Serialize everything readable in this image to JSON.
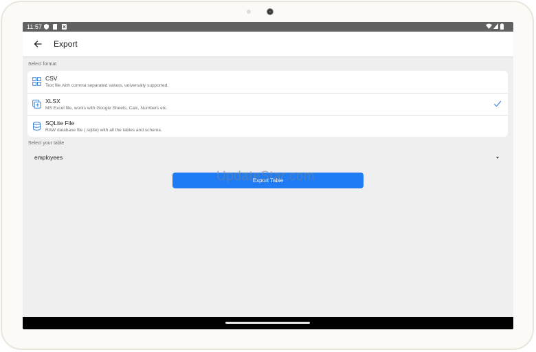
{
  "status_bar": {
    "time": "11:57",
    "left_icons": [
      "shield-icon",
      "sim-icon",
      "notification-icon"
    ],
    "right_icons": [
      "wifi-icon",
      "signal-icon",
      "battery-icon"
    ]
  },
  "app_bar": {
    "title": "Export",
    "back_icon": "arrow-left-icon"
  },
  "format_section": {
    "label": "Select format",
    "options": [
      {
        "name": "CSV",
        "description": "Text file with comma separated values, universally supported.",
        "icon": "grid-icon",
        "selected": false
      },
      {
        "name": "XLSX",
        "description": "MS Excel file, works with Google Sheets, Calc, Numbers etc.",
        "icon": "add-sheet-icon",
        "selected": true
      },
      {
        "name": "SQLite File",
        "description": "RAW database file (.sqlite) with all the tables and schema.",
        "icon": "database-icon",
        "selected": false
      }
    ]
  },
  "table_section": {
    "label": "Select your table",
    "selected_table": "employees"
  },
  "export_button": {
    "label": "Export Table"
  },
  "watermark": "UpdateStar.com",
  "colors": {
    "accent": "#1f7cf5",
    "background": "#efefef",
    "status_bar": "#616161",
    "icon_blue": "#3b82d6"
  }
}
